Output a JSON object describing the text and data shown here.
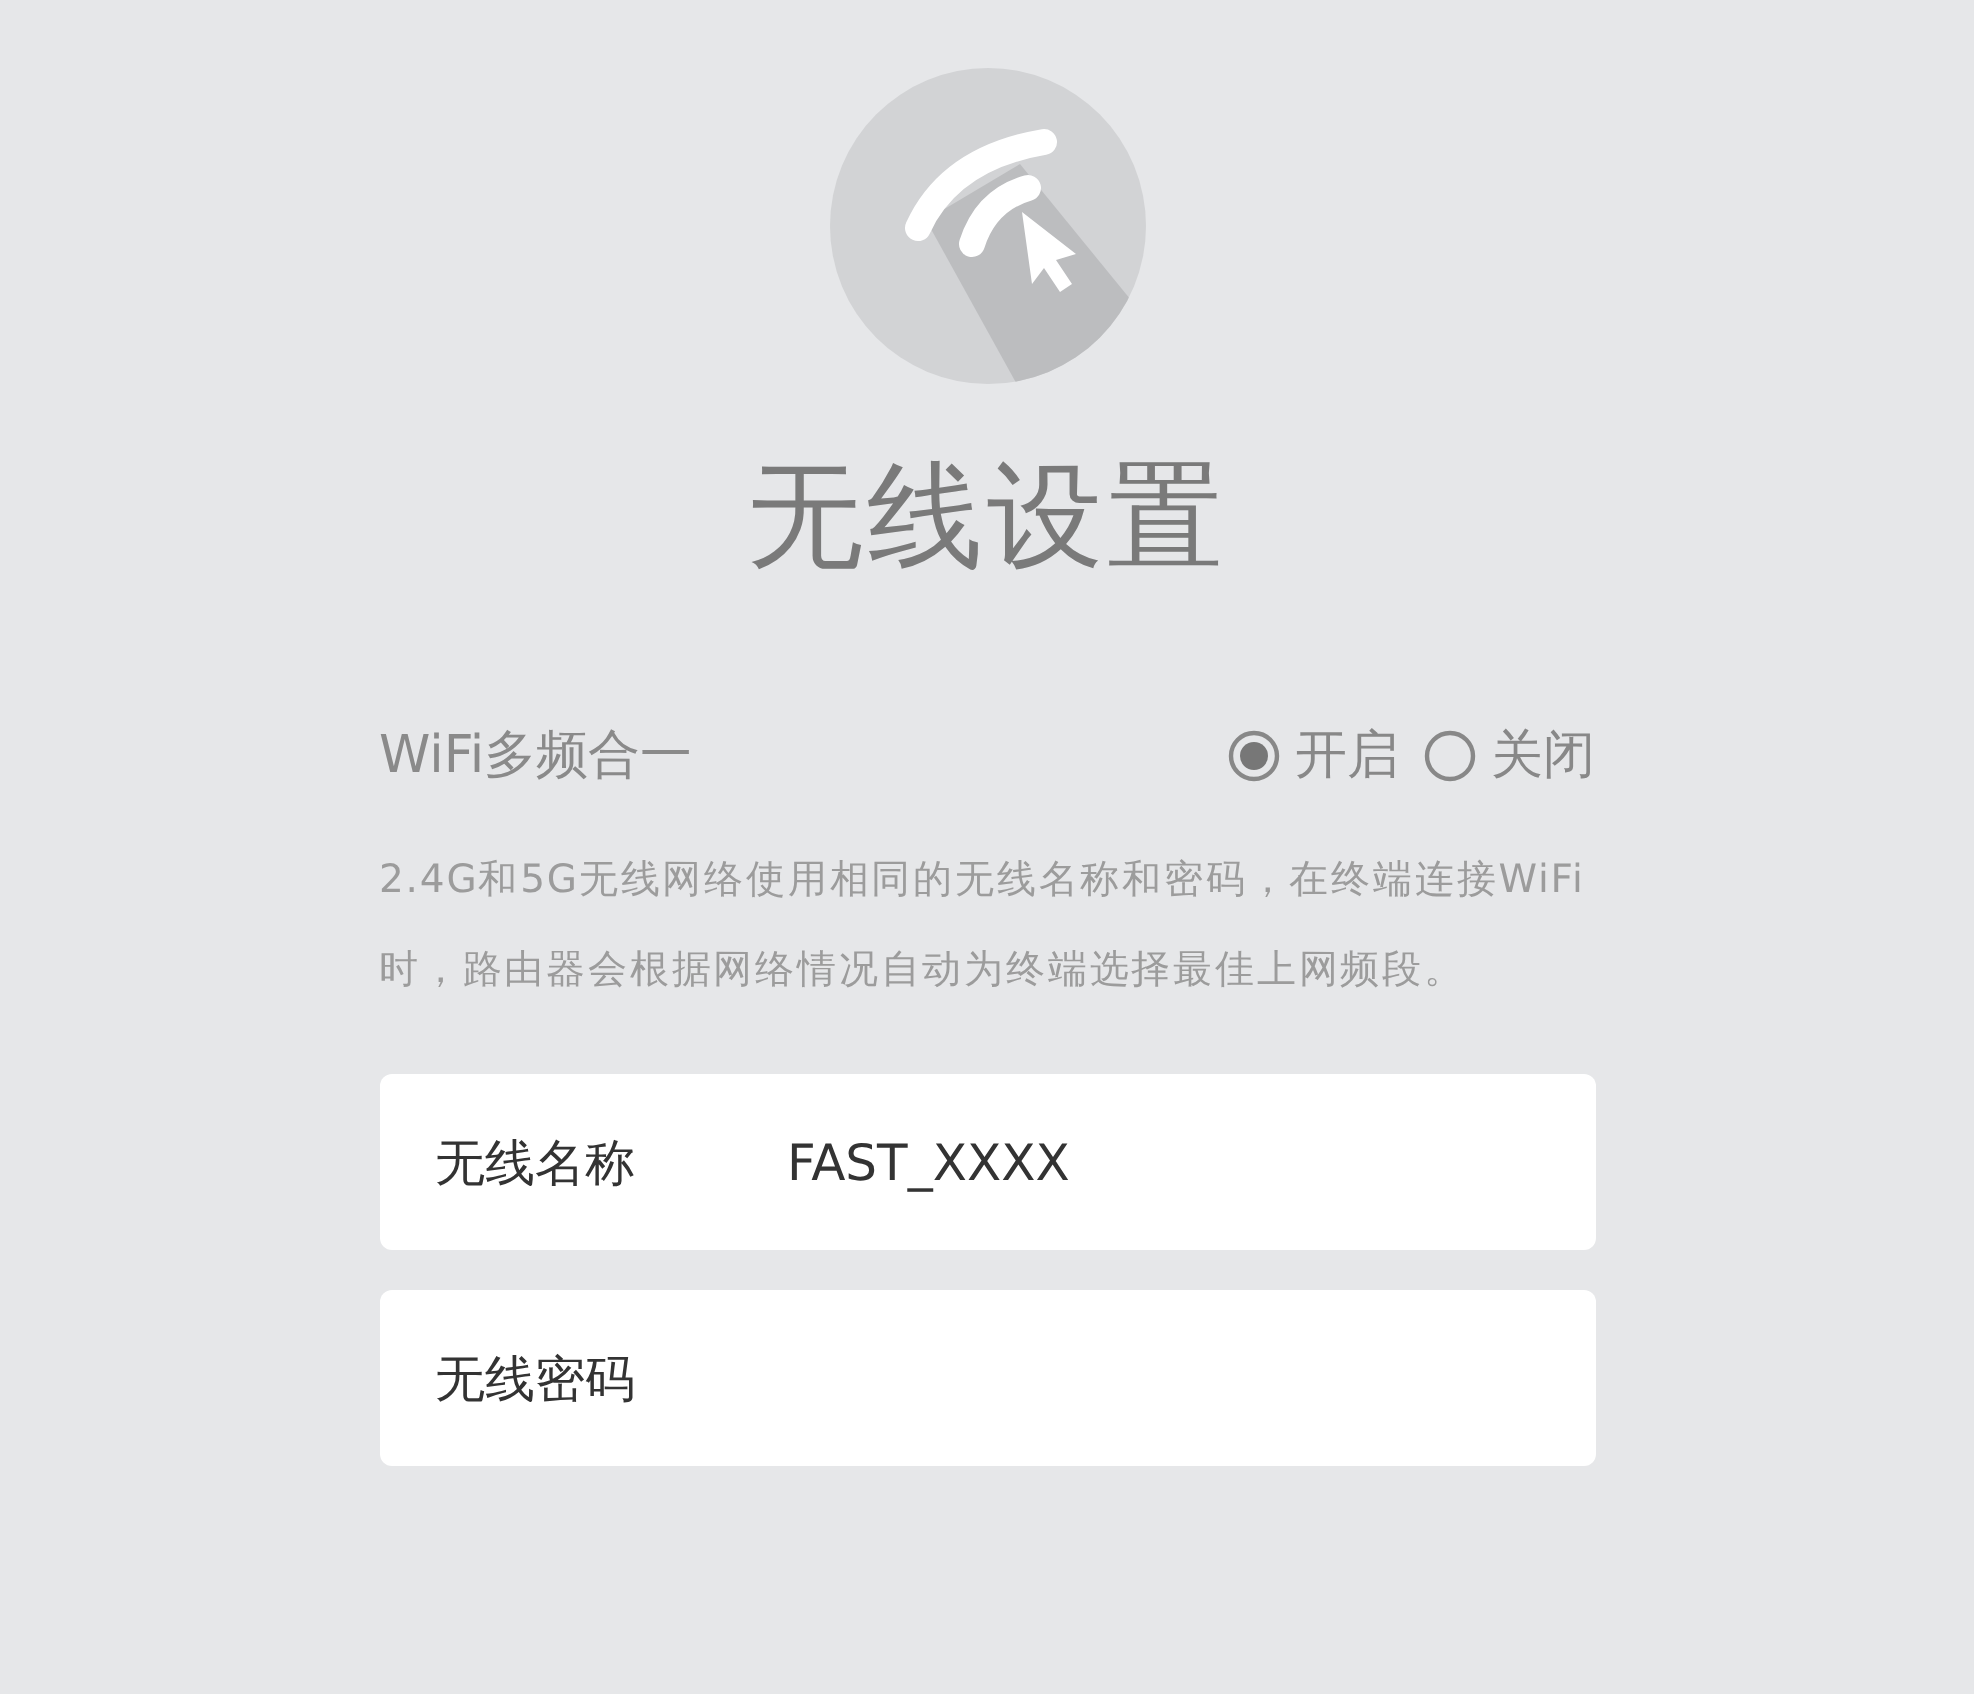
{
  "title": "无线设置",
  "multiband": {
    "label": "WiFi多频合一",
    "options": [
      {
        "label": "开启",
        "selected": true
      },
      {
        "label": "关闭",
        "selected": false
      }
    ]
  },
  "description": "2.4G和5G无线网络使用相同的无线名称和密码，在终端连接WiFi时，路由器会根据网络情况自动为终端选择最佳上网频段。",
  "fields": [
    {
      "label": "无线名称",
      "value": "FAST_XXXX"
    },
    {
      "label": "无线密码"
    }
  ]
}
